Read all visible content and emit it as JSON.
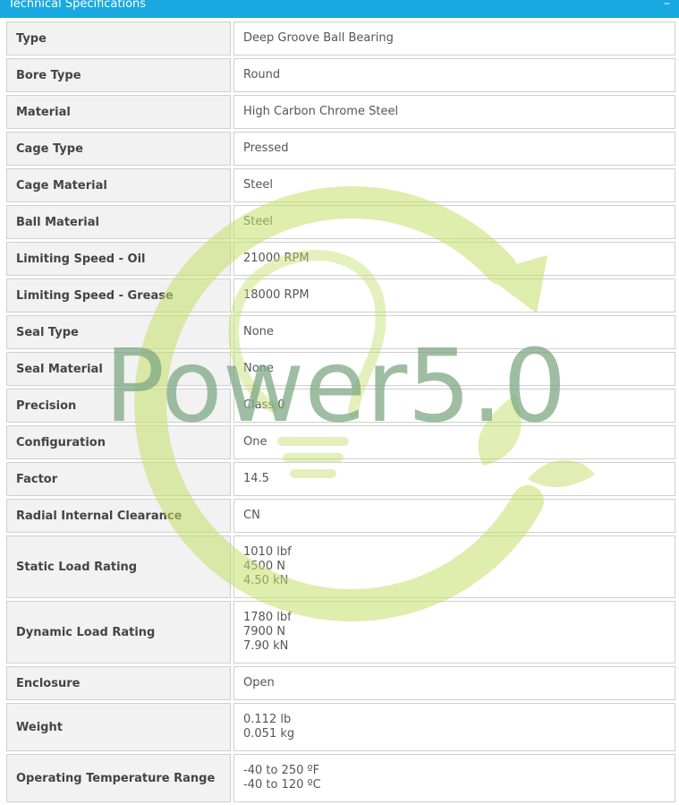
{
  "header": {
    "title": "Technical Specifications",
    "collapse_symbol": "–"
  },
  "watermark": {
    "text": "Power5.0",
    "text_color": "#7fa884",
    "ring_color": "#c4df6a"
  },
  "specs": [
    {
      "label": "Type",
      "values": [
        "Deep Groove Ball Bearing"
      ]
    },
    {
      "label": "Bore Type",
      "values": [
        "Round"
      ]
    },
    {
      "label": "Material",
      "values": [
        "High Carbon Chrome Steel"
      ]
    },
    {
      "label": "Cage Type",
      "values": [
        "Pressed"
      ]
    },
    {
      "label": "Cage Material",
      "values": [
        "Steel"
      ]
    },
    {
      "label": "Ball Material",
      "values": [
        "Steel"
      ]
    },
    {
      "label": "Limiting Speed - Oil",
      "values": [
        "21000 RPM"
      ]
    },
    {
      "label": "Limiting Speed - Grease",
      "values": [
        "18000 RPM"
      ]
    },
    {
      "label": "Seal Type",
      "values": [
        "None"
      ]
    },
    {
      "label": "Seal Material",
      "values": [
        "None"
      ]
    },
    {
      "label": "Precision",
      "values": [
        "Class 0"
      ]
    },
    {
      "label": "Configuration",
      "values": [
        "One"
      ]
    },
    {
      "label": "Factor",
      "values": [
        "14.5"
      ]
    },
    {
      "label": "Radial Internal Clearance",
      "values": [
        "CN"
      ]
    },
    {
      "label": "Static Load Rating",
      "values": [
        "1010 lbf",
        "4500 N",
        "4.50 kN"
      ]
    },
    {
      "label": "Dynamic Load Rating",
      "values": [
        "1780 lbf",
        "7900 N",
        "7.90 kN"
      ]
    },
    {
      "label": "Enclosure",
      "values": [
        "Open"
      ]
    },
    {
      "label": "Weight",
      "values": [
        "0.112 lb",
        "0.051 kg"
      ]
    },
    {
      "label": "Operating Temperature Range",
      "values": [
        "-40 to 250 ºF",
        "-40 to 120 ºC"
      ]
    }
  ]
}
